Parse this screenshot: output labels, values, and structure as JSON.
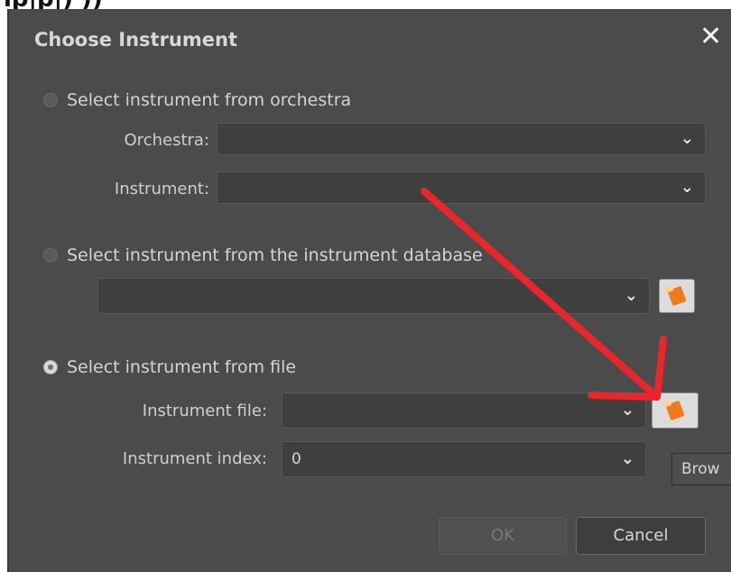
{
  "window": {
    "title": "Choose Instrument",
    "close_glyph": "✕"
  },
  "top_strip_text": "lp|p|) ))",
  "options": {
    "orchestra": {
      "label": "Select instrument from orchestra",
      "selected": false,
      "orchestra_label": "Orchestra:",
      "orchestra_value": "",
      "instrument_label": "Instrument:",
      "instrument_value": ""
    },
    "database": {
      "label": "Select instrument from the instrument database",
      "selected": false,
      "value": ""
    },
    "file": {
      "label": "Select instrument from file",
      "selected": true,
      "file_label": "Instrument file:",
      "file_value": "",
      "index_label": "Instrument index:",
      "index_value": "0"
    }
  },
  "icons": {
    "dropdown": "chevron-down-icon",
    "browse": "folder-open-icon"
  },
  "tooltip": "Brow",
  "buttons": {
    "ok": "OK",
    "cancel": "Cancel"
  },
  "colors": {
    "dialog_bg": "#4b4b4b",
    "annotation_arrow": "#e8262b"
  }
}
